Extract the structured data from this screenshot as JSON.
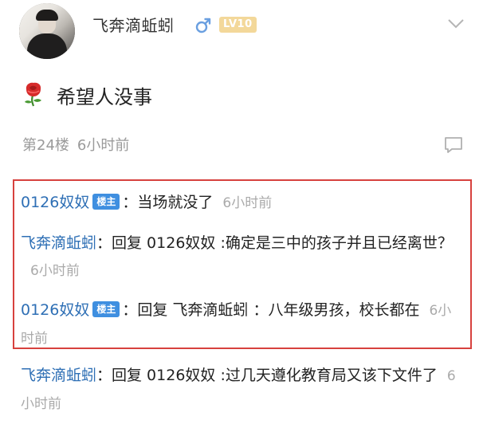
{
  "header": {
    "username": "飞奔滴蚯蚓",
    "gender_icon": "male-icon",
    "level_badge": "LV10",
    "level_color": "#f3d89a",
    "collapse_icon": "chevron-down-icon"
  },
  "post": {
    "emoji_icon": "rose-icon",
    "text": "希望人没事"
  },
  "floor": {
    "label": "第24楼",
    "time": "6小时前",
    "comment_icon": "comment-icon"
  },
  "replies": [
    {
      "name": "0126奴奴",
      "owner_badge": "楼主",
      "text": "：当场就没了",
      "time": "6小时前"
    },
    {
      "name": "飞奔滴蚯蚓",
      "text": "：回复 0126奴奴 :确定是三中的孩子并且已经离世？",
      "time": "6小时前"
    },
    {
      "name": "0126奴奴",
      "owner_badge": "楼主",
      "text": "：回复 飞奔滴蚯蚓 ：八年级男孩，校长都在",
      "time": "6小时前"
    },
    {
      "name": "飞奔滴蚯蚓",
      "text": "：回复 0126奴奴 :过几天遵化教育局又该下文件了",
      "time": "6小时前"
    }
  ],
  "colors": {
    "username_link": "#2e6fb5",
    "owner_badge": "#3f8fe0",
    "highlight_border": "#d7413e",
    "muted_text": "#9a9a9a"
  }
}
